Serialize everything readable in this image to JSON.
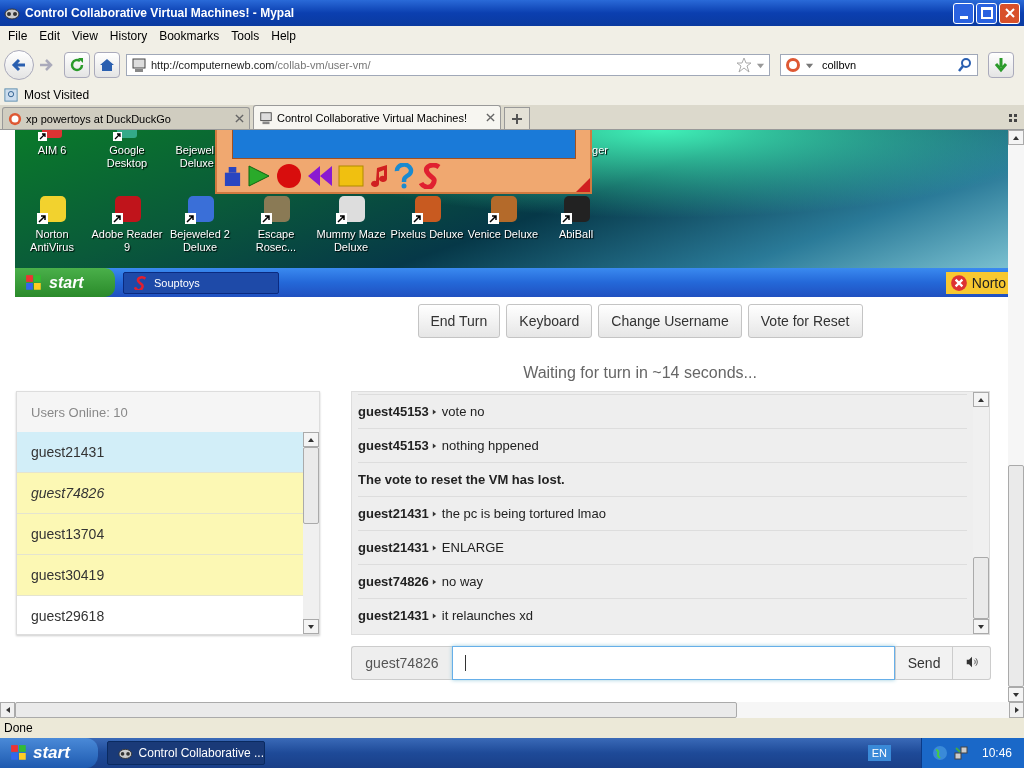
{
  "window": {
    "title": "Control Collaborative Virtual Machines! - Mypal"
  },
  "menu": [
    "File",
    "Edit",
    "View",
    "History",
    "Bookmarks",
    "Tools",
    "Help"
  ],
  "address": {
    "host": "http://computernewb.com",
    "path": "/collab-vm/user-vm/"
  },
  "search": {
    "value": "collbvn"
  },
  "bookmarks": [
    "Most Visited"
  ],
  "tabs": [
    {
      "label": "xp powertoys at DuckDuckGo",
      "selected": false
    },
    {
      "label": "Control Collaborative Virtual Machines!",
      "selected": true
    }
  ],
  "vm_screen": {
    "top_icons": [
      {
        "label": "AIM 6"
      },
      {
        "label": "Google Desktop"
      },
      {
        "label": "Bejewel Deluxe"
      },
      {
        "label": "ger"
      }
    ],
    "icons": [
      {
        "label": "Norton AntiVirus"
      },
      {
        "label": "Adobe Reader 9"
      },
      {
        "label": "Bejeweled 2 Deluxe"
      },
      {
        "label": "Escape Rosec..."
      },
      {
        "label": "Mummy Maze Deluxe"
      },
      {
        "label": "Pixelus Deluxe"
      },
      {
        "label": "Venice Deluxe"
      },
      {
        "label": "AbiBall"
      }
    ],
    "taskbar": {
      "start": "start",
      "tasks": [
        {
          "label": "Souptoys"
        }
      ],
      "notice": "Norto"
    }
  },
  "controls": [
    "End Turn",
    "Keyboard",
    "Change Username",
    "Vote for Reset"
  ],
  "turn_status": "Waiting for turn in ~14 seconds...",
  "users": {
    "header": "Users Online: 10",
    "items": [
      {
        "name": "guest21431",
        "kind": "turn",
        "self": false
      },
      {
        "name": "guest74826",
        "kind": "queued",
        "self": true
      },
      {
        "name": "guest13704",
        "kind": "queued",
        "self": false
      },
      {
        "name": "guest30419",
        "kind": "queued",
        "self": false
      },
      {
        "name": "guest29618",
        "kind": "idle",
        "self": false
      }
    ]
  },
  "chat": {
    "messages": [
      {
        "kind": "message",
        "user": "guest45153",
        "text": "vote no"
      },
      {
        "kind": "message",
        "user": "guest45153",
        "text": "nothing hppened"
      },
      {
        "kind": "system",
        "text": "The vote to reset the VM has lost."
      },
      {
        "kind": "message",
        "user": "guest21431",
        "text": "the pc is being tortured lmao"
      },
      {
        "kind": "message",
        "user": "guest21431",
        "text": "ENLARGE"
      },
      {
        "kind": "message",
        "user": "guest74826",
        "text": "no way"
      },
      {
        "kind": "message",
        "user": "guest21431",
        "text": "it relaunches xd"
      }
    ],
    "username": "guest74826",
    "send": "Send"
  },
  "status_bar": "Done",
  "taskbar": {
    "start": "start",
    "tasks": [
      {
        "label": "Control Collaborative ...",
        "selected": true
      }
    ],
    "language": "EN",
    "clock": "10:46"
  }
}
